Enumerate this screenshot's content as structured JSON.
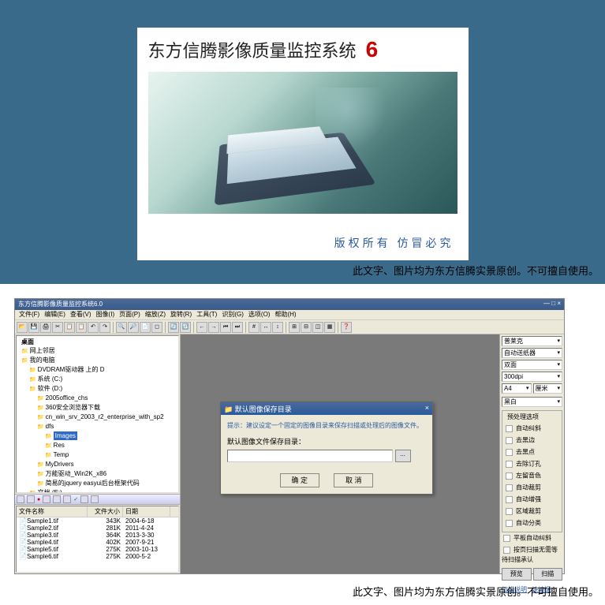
{
  "splash": {
    "title": "东方信腾影像质量监控系统",
    "version": "6",
    "copyright": "版权所有  仿冒必究"
  },
  "disclaimer": "此文字、图片均为东方信腾实景原创。不可擅自使用。",
  "app": {
    "title": "东方信腾影像质量监控系统6.0",
    "win_btns": "— □ ×",
    "menu": [
      "文件(F)",
      "编辑(E)",
      "查看(V)",
      "图像(I)",
      "页面(P)",
      "缩放(Z)",
      "旋转(R)",
      "工具(T)",
      "识别(G)",
      "选项(O)",
      "帮助(H)"
    ],
    "tree": {
      "root": "桌面",
      "items": [
        {
          "lv": 0,
          "t": "网上邻居"
        },
        {
          "lv": 0,
          "t": "我的电脑"
        },
        {
          "lv": 1,
          "t": "DVDRAM驱动器 上的 D"
        },
        {
          "lv": 1,
          "t": "系统 (C:)"
        },
        {
          "lv": 1,
          "t": "软件 (D:)"
        },
        {
          "lv": 2,
          "t": "2005office_chs"
        },
        {
          "lv": 2,
          "t": "360安全浏览器下载"
        },
        {
          "lv": 2,
          "t": "cn_win_srv_2003_r2_enterprise_with_sp2"
        },
        {
          "lv": 2,
          "t": "dfs"
        },
        {
          "lv": 3,
          "t": "Images",
          "sel": true
        },
        {
          "lv": 3,
          "t": "Res"
        },
        {
          "lv": 3,
          "t": "Temp"
        },
        {
          "lv": 2,
          "t": "MyDrivers"
        },
        {
          "lv": 2,
          "t": "万能驱动_Win2K_x86"
        },
        {
          "lv": 2,
          "t": "简易的jquery easyui后台框架代码"
        },
        {
          "lv": 1,
          "t": "文档 (E:)"
        }
      ]
    },
    "file_cols": [
      "文件名称",
      "文件大小",
      "日期"
    ],
    "files": [
      {
        "n": "Sample1.tif",
        "s": "343K",
        "d": "2004-6-18"
      },
      {
        "n": "Sample2.tif",
        "s": "281K",
        "d": "2011-4-24"
      },
      {
        "n": "Sample3.tif",
        "s": "364K",
        "d": "2013-3-30"
      },
      {
        "n": "Sample4.tif",
        "s": "402K",
        "d": "2007-9-21"
      },
      {
        "n": "Sample5.tif",
        "s": "275K",
        "d": "2003-10-13"
      },
      {
        "n": "Sample6.tif",
        "s": "275K",
        "d": "2000-5-2"
      }
    ]
  },
  "dialog": {
    "title": "默认图像保存目录",
    "close": "×",
    "hint": "提示：建议设定一个固定的图像目录来保存扫描或处理后的图像文件。",
    "label": "默认图像文件保存目录：",
    "browse": "...",
    "ok": "确 定",
    "cancel": "取 消"
  },
  "right": {
    "combos": [
      "普莱克",
      "自动送纸器",
      "双面",
      "300dpi"
    ],
    "paper": "A4",
    "unit": "厘米",
    "color": "黑白",
    "group_title": "预处理选项",
    "checks": [
      "自动纠斜",
      "去黑边",
      "去黑点",
      "去除订孔",
      "左留音色",
      "自动裁剪",
      "自动增强",
      "区域裁剪",
      "自动分类"
    ],
    "chk2a": "平板自动纠斜",
    "chk2b": "按页扫描无需等待扫描承认",
    "btn1": "预览",
    "btn2": "扫描",
    "link1": "扫描说明",
    "link2": "快捷键"
  }
}
